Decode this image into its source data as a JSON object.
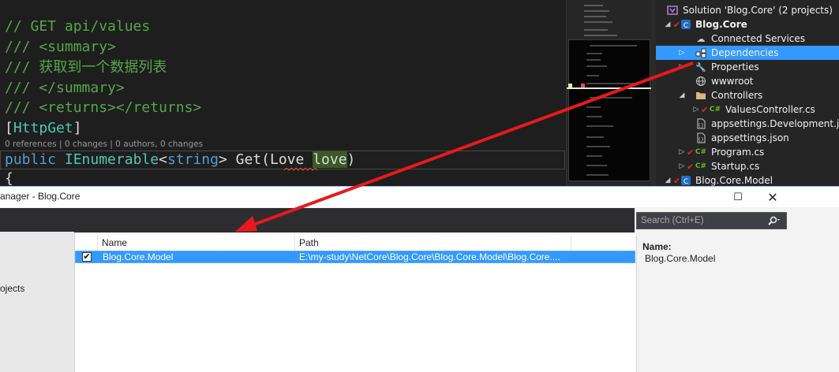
{
  "editor": {
    "lines": {
      "l1": "// GET api/values",
      "l2": "/// <summary>",
      "l3": "/// 获取到一个数据列表",
      "l4": "/// </summary>",
      "l5": "/// <returns></returns>",
      "l6_open": "[",
      "l6_attr": "HttpGet",
      "l6_close": "]",
      "l8_kw": "public",
      "l8_type": "IEnumerable",
      "l8_lt": "<",
      "l8_string": "string",
      "l8_rest": "> Get(Love ",
      "l8_param": "love",
      "l8_end": ")",
      "l9": "{"
    },
    "codelens": "0 references | 0 changes | 0 authors, 0 changes"
  },
  "solution_explorer": {
    "items": [
      {
        "label": "Solution 'Blog.Core' (2 projects)",
        "icon": "solution-icon"
      },
      {
        "label": "Blog.Core",
        "icon": "csharp-project-icon"
      },
      {
        "label": "Connected Services",
        "icon": "connected-services-icon"
      },
      {
        "label": "Dependencies",
        "icon": "dependencies-icon"
      },
      {
        "label": "Properties",
        "icon": "wrench-icon"
      },
      {
        "label": "wwwroot",
        "icon": "globe-icon"
      },
      {
        "label": "Controllers",
        "icon": "folder-icon"
      },
      {
        "label": "ValuesController.cs",
        "icon": "csharp-file-icon"
      },
      {
        "label": "appsettings.Development.json",
        "icon": "json-file-icon"
      },
      {
        "label": "appsettings.json",
        "icon": "json-file-icon"
      },
      {
        "label": "Program.cs",
        "icon": "csharp-file-icon"
      },
      {
        "label": "Startup.cs",
        "icon": "csharp-file-icon"
      },
      {
        "label": "Blog.Core.Model",
        "icon": "csharp-project-icon"
      }
    ],
    "file_badge": "C#"
  },
  "dialog": {
    "title": "anager - Blog.Core",
    "maximize": "☐",
    "close": "✕",
    "left_nav_item": "ojects",
    "search_placeholder": "Search (Ctrl+E)",
    "search_icon": "search-icon",
    "columns": {
      "name": "Name",
      "path": "Path"
    },
    "rows": [
      {
        "checked": true,
        "check_mark": "✔",
        "name": "Blog.Core.Model",
        "path": "E:\\my-study\\NetCore\\Blog.Core\\Blog.Core.Model\\Blog.Core...."
      }
    ],
    "details": {
      "label": "Name:",
      "value": "Blog.Core.Model"
    }
  },
  "colors": {
    "editor_bg": "#1e1e1e",
    "comment": "#57a64a",
    "keyword": "#569cd6",
    "type": "#4ec9b0",
    "selection": "#3399ff",
    "arrow": "#e8191c"
  }
}
